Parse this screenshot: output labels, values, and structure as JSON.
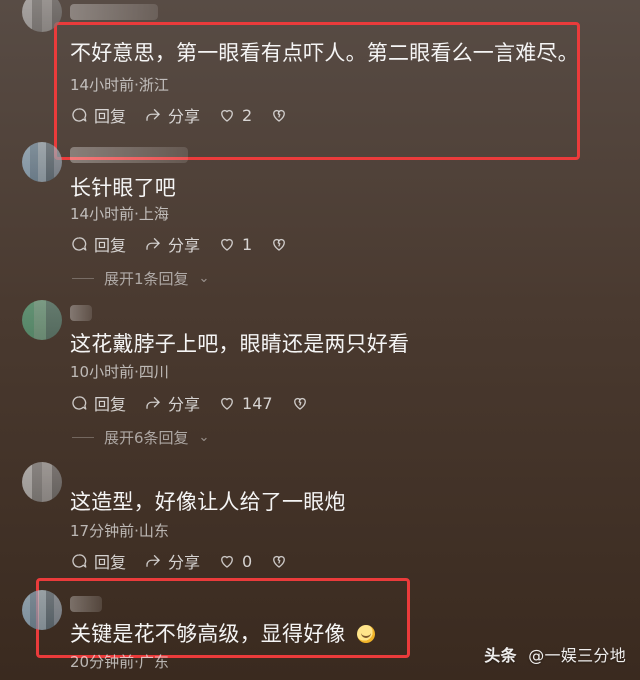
{
  "comments": [
    {
      "content": "不好意思，第一眼看有点吓人。第二眼看么一言难尽。",
      "meta": "14小时前·浙江",
      "actions": {
        "reply": "回复",
        "share": "分享",
        "likes": "2"
      },
      "expand": null
    },
    {
      "content": "长针眼了吧",
      "meta": "14小时前·上海",
      "actions": {
        "reply": "回复",
        "share": "分享",
        "likes": "1"
      },
      "expand": "展开1条回复"
    },
    {
      "content": "这花戴脖子上吧，眼睛还是两只好看",
      "meta": "10小时前·四川",
      "actions": {
        "reply": "回复",
        "share": "分享",
        "likes": "147"
      },
      "expand": "展开6条回复"
    },
    {
      "content": "这造型，好像让人给了一眼炮",
      "meta": "17分钟前·山东",
      "actions": {
        "reply": "回复",
        "share": "分享",
        "likes": "0"
      },
      "expand": null
    },
    {
      "content": "关键是花不够高级，显得好像",
      "meta": "20分钟前·广东",
      "actions": null,
      "expand": null
    }
  ],
  "watermark": {
    "brand": "头条",
    "handle": "@一娱三分地"
  },
  "colors": {
    "highlight": "#ea3b3b"
  }
}
